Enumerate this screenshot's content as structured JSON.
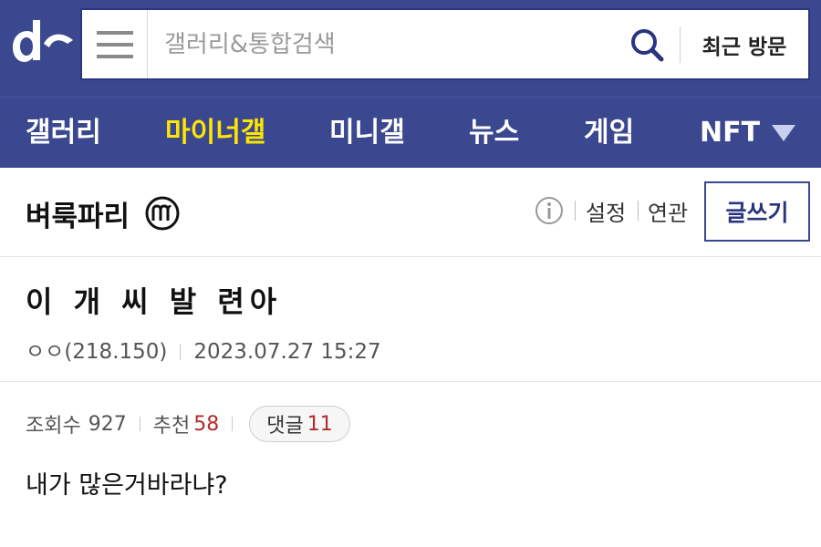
{
  "header": {
    "logo_icon": "dc-logo-icon",
    "menu_icon": "hamburger-menu-icon",
    "search_placeholder": "갤러리&통합검색",
    "search_value": "",
    "search_icon": "search-icon",
    "recent_label": "최근 방문"
  },
  "nav": {
    "items": [
      {
        "label": "갤러리",
        "active": false
      },
      {
        "label": "마이너갤",
        "active": true
      },
      {
        "label": "미니갤",
        "active": false
      },
      {
        "label": "뉴스",
        "active": false
      },
      {
        "label": "게임",
        "active": false
      },
      {
        "label": "NFT",
        "active": false
      }
    ],
    "more_icon": "triangle-down-icon"
  },
  "gallery": {
    "title": "벼룩파리",
    "badge_icon": "minor-gallery-m-icon",
    "info_icon": "info-icon",
    "settings_label": "설정",
    "related_label": "연관",
    "write_label": "글쓰기"
  },
  "post": {
    "title": "이 개 씨 발 련아",
    "author": "ㅇㅇ(218.150)",
    "datetime": "2023.07.27 15:27",
    "views_label": "조회수",
    "views": "927",
    "recommend_label": "추천",
    "recommend": "58",
    "comments_label": "댓글",
    "comments": "11",
    "body": "내가 많은거바라냐?"
  },
  "colors": {
    "brand": "#3b4890",
    "active_nav": "#ffe600",
    "highlight": "#b02b2b"
  }
}
